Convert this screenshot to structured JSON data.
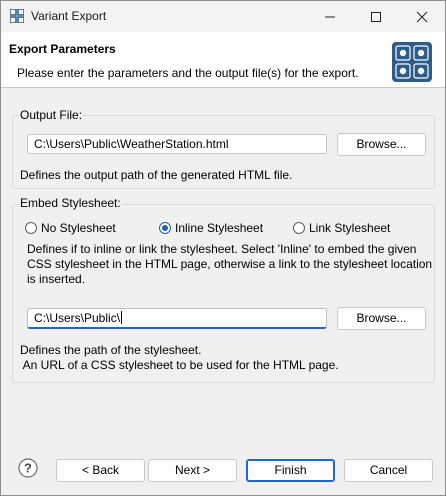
{
  "window": {
    "title": "Variant Export"
  },
  "banner": {
    "title": "Export Parameters",
    "description": "Please enter the parameters and the output file(s) for the export."
  },
  "output_file": {
    "label": "Output File:",
    "value": "C:\\Users\\Public\\WeatherStation.html",
    "browse_label": "Browse...",
    "hint": "Defines the output path of the generated HTML file."
  },
  "stylesheet": {
    "label": "Embed Stylesheet:",
    "options": [
      "No Stylesheet",
      "Inline Stylesheet",
      "Link Stylesheet"
    ],
    "selected": "Inline Stylesheet",
    "desc_lines": [
      "Defines if to inline or link the stylesheet. Select 'Inline' to embed the given",
      "CSS stylesheet in the HTML page, otherwise a link to the stylesheet location",
      "is inserted."
    ],
    "path_value": "C:\\Users\\Public\\",
    "browse_label": "Browse...",
    "hint_lines": [
      "Defines the path of the stylesheet.",
      " An URL of a CSS stylesheet to be used for the HTML page."
    ]
  },
  "footer": {
    "back_label": "< Back",
    "next_label": "Next >",
    "finish_label": "Finish",
    "cancel_label": "Cancel"
  },
  "colors": {
    "accent": "#1e66c8",
    "banner_icon": "#2e5c8a"
  },
  "icons": [
    "app-grid-icon",
    "minimize-icon",
    "maximize-icon",
    "close-icon",
    "export-grid-icon",
    "help-icon"
  ]
}
